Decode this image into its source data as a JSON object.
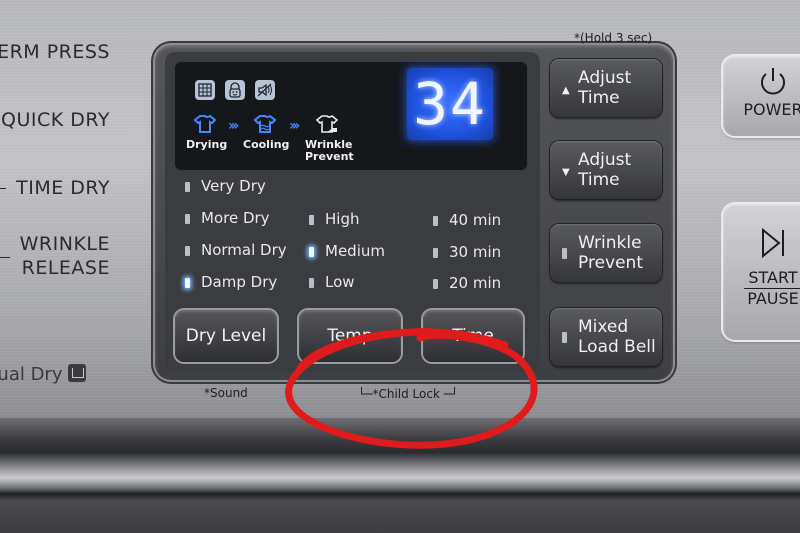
{
  "cycles": {
    "items": [
      {
        "label": "PERM PRESS"
      },
      {
        "label": "QUICK DRY"
      },
      {
        "label": "TIME DRY"
      },
      {
        "label": "WRINKLE\nRELEASE"
      }
    ],
    "manual_dry": "nual Dry"
  },
  "display": {
    "status_icons": [
      "lint-filter-icon",
      "child-lock-icon",
      "sound-off-icon"
    ],
    "stages": [
      {
        "label": "Drying",
        "icon": "shirt-drying-icon",
        "active": true
      },
      {
        "label": "Cooling",
        "icon": "shirt-cooling-icon",
        "active": true
      },
      {
        "label": "Wrinkle\nPrevent",
        "icon": "shirt-wrinkle-prevent-icon",
        "active": false
      }
    ],
    "readout": "34",
    "accent": "#2b5df0"
  },
  "dry_level": {
    "options": [
      {
        "label": "Very Dry",
        "selected": false
      },
      {
        "label": "More Dry",
        "selected": false
      },
      {
        "label": "Normal Dry",
        "selected": false
      },
      {
        "label": "Damp Dry",
        "selected": true
      }
    ],
    "button": "Dry Level",
    "secondary": "*Sound"
  },
  "temp": {
    "options": [
      {
        "label": "High",
        "selected": false
      },
      {
        "label": "Medium",
        "selected": true
      },
      {
        "label": "Low",
        "selected": false
      }
    ],
    "button": "Temp"
  },
  "time": {
    "options": [
      {
        "label": "40 min",
        "selected": false
      },
      {
        "label": "30 min",
        "selected": false
      },
      {
        "label": "20 min",
        "selected": false
      }
    ],
    "button": "Time"
  },
  "child_lock_label": "*Child Lock",
  "right_buttons": {
    "hold_note": "*(Hold 3 sec)",
    "adjust_up": "Adjust\nTime",
    "adjust_down": "Adjust\nTime",
    "wrinkle_prevent": "Wrinkle\nPrevent",
    "mixed_load_bell": "Mixed\nLoad Bell"
  },
  "power": {
    "label": "POWER"
  },
  "start_pause": {
    "start": "START",
    "pause": "PAUSE"
  },
  "annotation": {
    "color": "#e01b1b",
    "target": "Child Lock"
  }
}
